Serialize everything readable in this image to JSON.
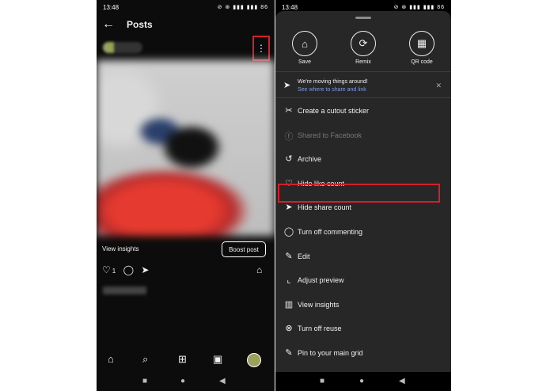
{
  "left": {
    "status": {
      "time": "13:48",
      "icons": "⊘ ⊛ ▮▮▮ ▮▮▮ 86"
    },
    "header": {
      "title": "Posts",
      "back_glyph": "←"
    },
    "post": {
      "more_glyph": "⋮",
      "view_insights": "View insights",
      "boost_label": "Boost post",
      "like_icon": "♡",
      "like_count": "1",
      "comment_icon": "◯",
      "share_icon": "➤",
      "save_icon": "⌂"
    },
    "bottom_nav": {
      "home": "⌂",
      "search": "⌕",
      "create": "⊞",
      "reels": "▣"
    },
    "system_nav": {
      "recents": "■",
      "home": "●",
      "back": "◀"
    }
  },
  "right": {
    "status": {
      "time": "13:48",
      "icons": "⊘ ⊛ ▮▮▮ ▮▮▮ 86"
    },
    "quick_actions": [
      {
        "label": "Save",
        "icon": "bookmark-icon",
        "glyph": "⌂"
      },
      {
        "label": "Remix",
        "icon": "remix-icon",
        "glyph": "⟳"
      },
      {
        "label": "QR code",
        "icon": "qr-code-icon",
        "glyph": "▦"
      }
    ],
    "notice": {
      "title": "We're moving things around!",
      "link": "See where to share and link",
      "icon_glyph": "➤",
      "close_glyph": "✕"
    },
    "menu": [
      {
        "label": "Create a cutout sticker",
        "icon": "scissors-icon",
        "glyph": "✂",
        "disabled": false
      },
      {
        "label": "Shared to Facebook",
        "icon": "facebook-icon",
        "glyph": "ⓕ",
        "disabled": true
      },
      {
        "label": "Archive",
        "icon": "archive-icon",
        "glyph": "↺",
        "disabled": false
      },
      {
        "label": "Hide like count",
        "icon": "heart-off-icon",
        "glyph": "♡",
        "disabled": false,
        "highlighted": true
      },
      {
        "label": "Hide share count",
        "icon": "share-off-icon",
        "glyph": "➤",
        "disabled": false
      },
      {
        "label": "Turn off commenting",
        "icon": "comment-off-icon",
        "glyph": "◯",
        "disabled": false
      },
      {
        "label": "Edit",
        "icon": "pencil-icon",
        "glyph": "✎",
        "disabled": false
      },
      {
        "label": "Adjust preview",
        "icon": "crop-icon",
        "glyph": "⌞",
        "disabled": false
      },
      {
        "label": "View insights",
        "icon": "bar-chart-icon",
        "glyph": "▥",
        "disabled": false
      },
      {
        "label": "Turn off reuse",
        "icon": "x-circle-icon",
        "glyph": "⊗",
        "disabled": false
      },
      {
        "label": "Pin to your main grid",
        "icon": "pin-icon",
        "glyph": "✎",
        "disabled": false
      }
    ],
    "system_nav": {
      "recents": "■",
      "home": "●",
      "back": "◀"
    }
  },
  "colors": {
    "highlight": "#d3202a",
    "link": "#7a9bf1",
    "sheet": "#272727"
  }
}
